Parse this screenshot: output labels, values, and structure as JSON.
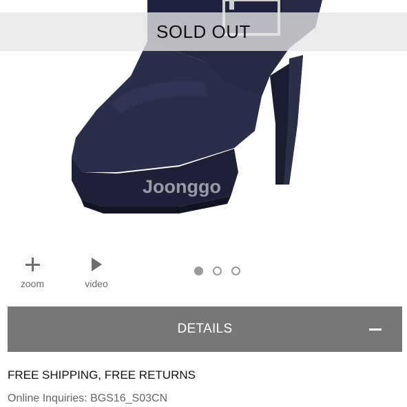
{
  "product_image": {
    "badge": "SOLD OUT",
    "watermark": "Joonggo"
  },
  "tools": {
    "zoom_label": "zoom",
    "video_label": "video"
  },
  "carousel": {
    "count": 3,
    "active_index": 0
  },
  "details": {
    "label": "DETAILS",
    "expanded": true
  },
  "info": {
    "shipping": "FREE SHIPPING, FREE RETURNS",
    "inquiry": "Online Inquiries: BGS16_S03CN"
  },
  "colors": {
    "boot": "#262a45",
    "details_bar": "#777777",
    "icon_gray": "#6d6d6d"
  },
  "icons": {
    "zoom": "plus-icon",
    "video": "play-icon",
    "collapse": "minus-icon"
  }
}
